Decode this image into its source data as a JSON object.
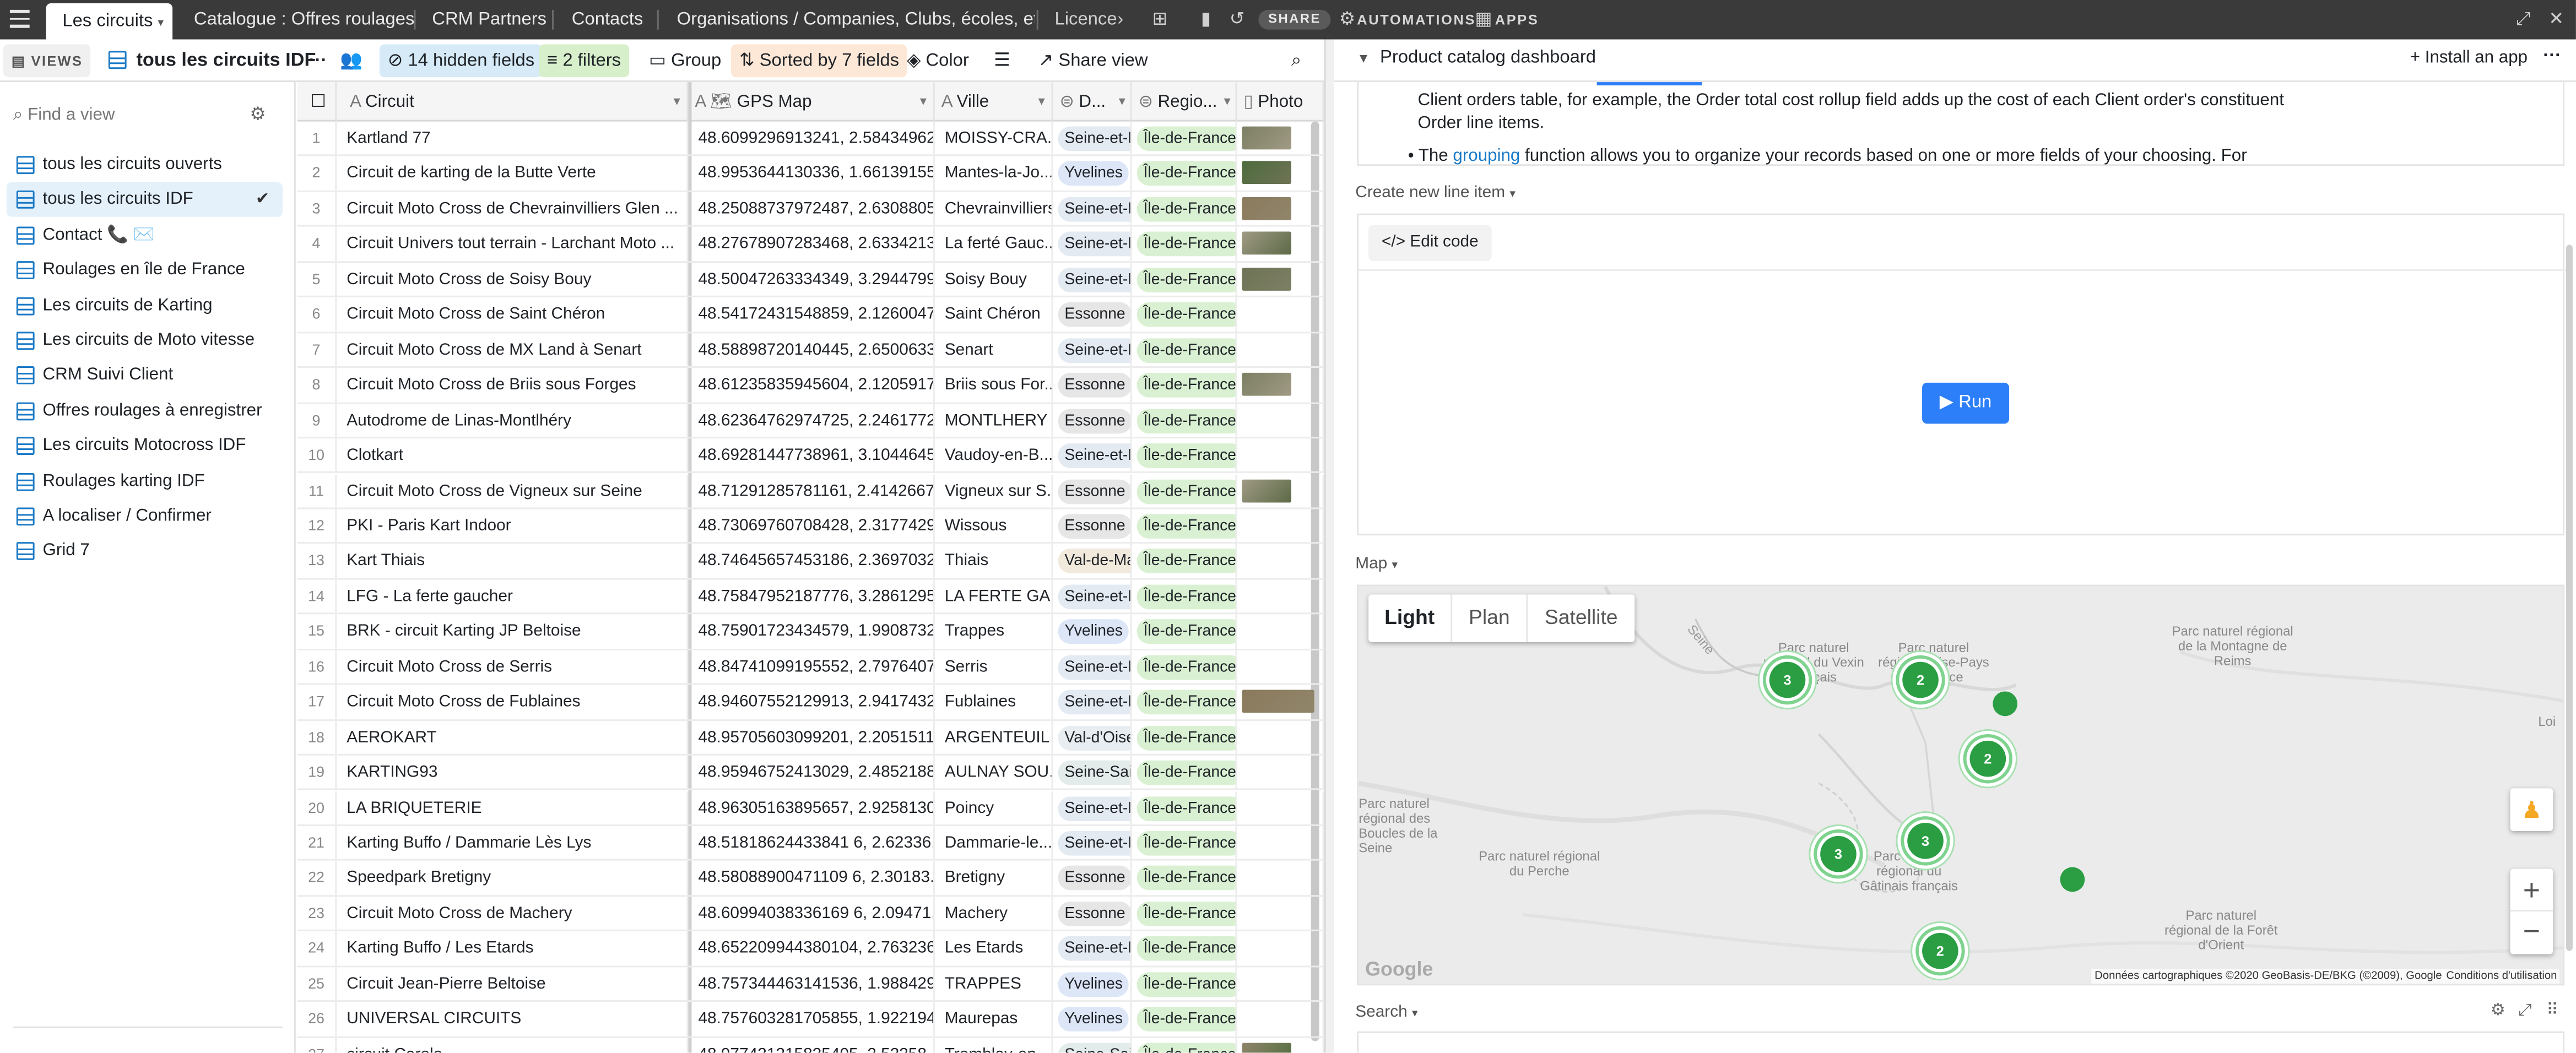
{
  "topbar": {
    "tabs": [
      "Les circuits",
      "Catalogue : Offres roulages",
      "CRM Partners",
      "Contacts",
      "Organisations / Companies, Clubs, écoles, etc.",
      "Licence"
    ],
    "share": "SHARE",
    "automations": "AUTOMATIONS",
    "apps": "APPS"
  },
  "viewbar": {
    "views": "VIEWS",
    "current_view": "tous les circuits IDF",
    "hidden_fields": "14 hidden fields",
    "filters": "2 filters",
    "group": "Group",
    "sorted": "Sorted by 7 fields",
    "color": "Color",
    "share_view": "Share view"
  },
  "sidebar": {
    "find_placeholder": "Find a view",
    "items": [
      "tous les circuits ouverts",
      "tous les circuits IDF",
      "Contact 📞 ✉️",
      "Roulages en île de France",
      "Les circuits de Karting",
      "Les circuits de Moto vitesse",
      "CRM Suivi Client",
      "Offres roulages à enregistrer",
      "Les circuits Motocross IDF",
      "Roulages karting IDF",
      "A localiser / Confirmer",
      "Grid 7"
    ]
  },
  "grid": {
    "columns": [
      "Circuit",
      "GPS Map",
      "Ville",
      "D...",
      "Regio...",
      "Photo"
    ],
    "rows": [
      [
        "1",
        "Kartland 77",
        "48.6099296913241, 2.58434962...",
        "MOISSY-CRA...",
        "Seine-et-M",
        "Île-de-France",
        "p"
      ],
      [
        "2",
        "Circuit de karting de la Butte Verte",
        "48.9953644130336, 1.66139155...",
        "Mantes-la-Jo...",
        "Yvelines",
        "Île-de-France",
        "p"
      ],
      [
        "3",
        "Circuit Moto Cross de Chevrainvilliers Glen ...",
        "48.25088737972487, 2.6308805...",
        "Chevrainvilliers",
        "Seine-et-M",
        "Île-de-France",
        "p"
      ],
      [
        "4",
        "Circuit Univers tout terrain - Larchant Moto ...",
        "48.27678907283468, 2.63342131...",
        "La ferté Gauc...",
        "Seine-et-M",
        "Île-de-France",
        "p"
      ],
      [
        "5",
        "Circuit Moto Cross de Soisy Bouy",
        "48.50047263334349, 3.29447999...",
        "Soisy Bouy",
        "Seine-et-M",
        "Île-de-France",
        "p"
      ],
      [
        "6",
        "Circuit Moto Cross de Saint Chéron",
        "48.54172431548859, 2.12600477...",
        "Saint Chéron",
        "Essonne",
        "Île-de-France",
        ""
      ],
      [
        "7",
        "Circuit Moto Cross de MX Land à Senart",
        "48.58898720140445, 2.65006332...",
        "Senart",
        "Seine-et-M",
        "Île-de-France",
        ""
      ],
      [
        "8",
        "Circuit Moto Cross de Briis sous Forges",
        "48.61235835945604, 2.12059171...",
        "Briis sous For...",
        "Essonne",
        "Île-de-France",
        "p"
      ],
      [
        "9",
        "Autodrome de Linas-Montlhéry",
        "48.62364762974725, 2.24617727...",
        "MONTLHERY",
        "Essonne",
        "Île-de-France",
        ""
      ],
      [
        "10",
        "Clotkart",
        "48.69281447738961, 3.10446454...",
        "Vaudoy-en-B...",
        "Seine-et-M",
        "Île-de-France",
        ""
      ],
      [
        "11",
        "Circuit Moto Cross de Vigneux sur Seine",
        "48.71291285781161, 2.41426678...",
        "Vigneux sur S...",
        "Essonne",
        "Île-de-France",
        "p"
      ],
      [
        "12",
        "PKI - Paris Kart Indoor",
        "48.73069760708428, 2.31774293...",
        "Wissous",
        "Essonne",
        "Île-de-France",
        ""
      ],
      [
        "13",
        "Kart Thiais",
        "48.74645657453186, 2.36970323...",
        "Thiais",
        "Val-de-Ma",
        "Île-de-France",
        ""
      ],
      [
        "14",
        "LFG - La ferte gaucher",
        "48.75847952187776, 3.28612957...",
        "LA FERTE GA...",
        "Seine-et-M",
        "Île-de-France",
        ""
      ],
      [
        "15",
        "BRK - circuit Karting JP Beltoise",
        "48.75901723434579, 1.99087321...",
        "Trappes",
        "Yvelines",
        "Île-de-France",
        ""
      ],
      [
        "16",
        "Circuit Moto Cross de Serris",
        "48.84741099195552, 2.79764077...",
        "Serris",
        "Seine-et-M",
        "Île-de-France",
        ""
      ],
      [
        "17",
        "Circuit Moto Cross de Fublaines",
        "48.94607552129913, 2.94174326...",
        "Fublaines",
        "Seine-et-M",
        "Île-de-France",
        "pw"
      ],
      [
        "18",
        "AEROKART",
        "48.95705603099201, 2.20515114...",
        "ARGENTEUIL",
        "Val-d'Oise",
        "Île-de-France",
        ""
      ],
      [
        "19",
        "KARTING93",
        "48.95946752413029, 2.48521888...",
        "AULNAY SOU...",
        "Seine-Sain",
        "Île-de-France",
        ""
      ],
      [
        "20",
        "LA BRIQUETERIE",
        "48.96305163895657, 2.92581305...",
        "Poincy",
        "Seine-et-M",
        "Île-de-France",
        ""
      ],
      [
        "21",
        "Karting Buffo / Dammarie Lès Lys",
        "48.51818624433841 6, 2.62336...",
        "Dammarie-le...",
        "Seine-et-M",
        "Île-de-France",
        ""
      ],
      [
        "22",
        "Speedpark Bretigny",
        "48.58088900471109 6, 2.30183...",
        "Bretigny",
        "Essonne",
        "Île-de-France",
        ""
      ],
      [
        "23",
        "Circuit Moto Cross de Machery",
        "48.60994038336169 6, 2.09471...",
        "Machery",
        "Essonne",
        "Île-de-France",
        ""
      ],
      [
        "24",
        "Karting Buffo / Les Etards",
        "48.652209944380104, 2.763236...",
        "Les Etards",
        "Seine-et-M",
        "Île-de-France",
        ""
      ],
      [
        "25",
        "Circuit Jean-Pierre Beltoise",
        "48.757344463141536, 1.988429...",
        "TRAPPES",
        "Yvelines",
        "Île-de-France",
        ""
      ],
      [
        "26",
        "UNIVERSAL CIRCUITS",
        "48.757603281705855, 1.922194...",
        "Maurepas",
        "Yvelines",
        "Île-de-France",
        ""
      ],
      [
        "27",
        "circuit Carole",
        "48.977431215835405, 2.52358...",
        "Tremblay-en...",
        "Seine-Sain",
        "Île-de-France",
        "p"
      ]
    ]
  },
  "dept_colors": {
    "Seine-et-M": "#e4eaf2",
    "Yvelines": "#dde6f7",
    "Essonne": "#e6e6e6",
    "Val-de-Ma": "#f0e9dc",
    "Val-d'Oise": "#e7edf0",
    "Seine-Sain": "#e3ecea"
  },
  "region_color": "#d9f1d2",
  "right": {
    "app_title": "Product catalog dashboard",
    "install": "Install an app",
    "text_line1": "Client orders table, for example, the Order total cost rollup field adds up the cost of each Client order's constituent",
    "text_line2": "Order line items.",
    "bullet_pre": "The ",
    "bullet_link": "grouping",
    "bullet_post": " function allows you to organize your records based on one or more fields of your choosing. For",
    "create_label": "Create new line item",
    "edit_code": "Edit code",
    "run": "Run",
    "map_label": "Map",
    "map_tabs": [
      "Light",
      "Plan",
      "Satellite"
    ],
    "map_labels": {
      "vexin": "Parc naturel régional du Vexin français",
      "oise": "Parc naturel régional Oise-Pays de France",
      "reims": "Parc naturel régional de la Montagne de Reims",
      "perche": "Parc naturel régional du Perche",
      "gatinais": "Parc naturel régional du Gâtinais français",
      "orient": "Parc naturel régional de la Forêt d'Orient",
      "normandie": "Parc naturel régional des Boucles de la Seine Normande",
      "seine": "Seine",
      "loire": "Loi",
      "google": "Google",
      "attribution": "Données cartographiques ©2020 GeoBasis-DE/BKG (©2009), Google",
      "terms": "Conditions d'utilisation"
    },
    "clusters": [
      "3",
      "2",
      "2",
      "3",
      "3",
      "2"
    ],
    "search_label": "Search"
  }
}
